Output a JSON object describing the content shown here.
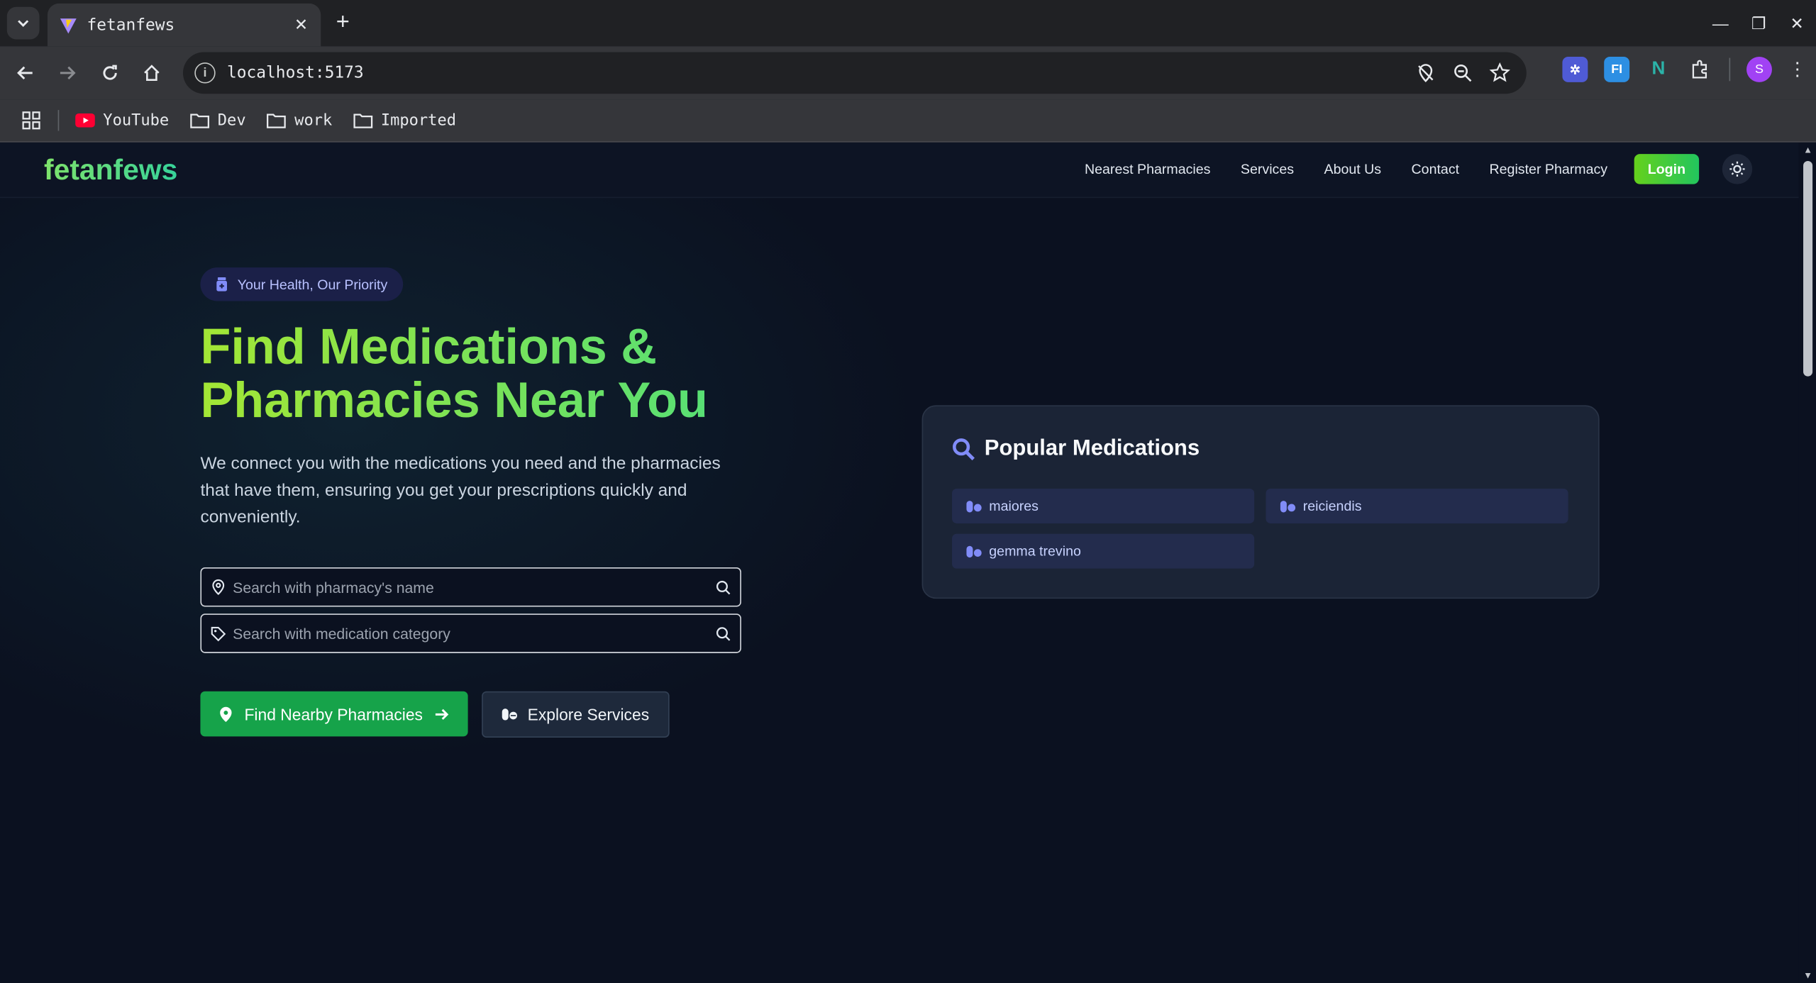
{
  "browser": {
    "tab_title": "fetanfews",
    "url": "localhost:5173",
    "bookmarks": [
      "YouTube",
      "Dev",
      "work",
      "Imported"
    ],
    "profile_initial": "S",
    "extensions": [
      "FI"
    ]
  },
  "nav": {
    "brand": "fetanfews",
    "links": [
      "Nearest Pharmacies",
      "Services",
      "About Us",
      "Contact",
      "Register Pharmacy"
    ],
    "login_label": "Login"
  },
  "hero": {
    "badge": "Your Health, Our Priority",
    "title": "Find Medications & Pharmacies Near You",
    "description": "We connect you with the medications you need and the pharmacies that have them, ensuring you get your prescriptions quickly and conveniently.",
    "search_pharmacy_placeholder": "Search with pharmacy's name",
    "search_category_placeholder": "Search with medication category",
    "primary_button": "Find Nearby Pharmacies",
    "secondary_button": "Explore Services"
  },
  "popular": {
    "title": "Popular Medications",
    "items": [
      "maiores",
      "reiciendis",
      "gemma trevino"
    ]
  },
  "colors": {
    "accent_green": "#16a34a",
    "brand_gradient_start": "#a3e635",
    "brand_gradient_end": "#4ade80",
    "pill_icon": "#818cf8"
  }
}
